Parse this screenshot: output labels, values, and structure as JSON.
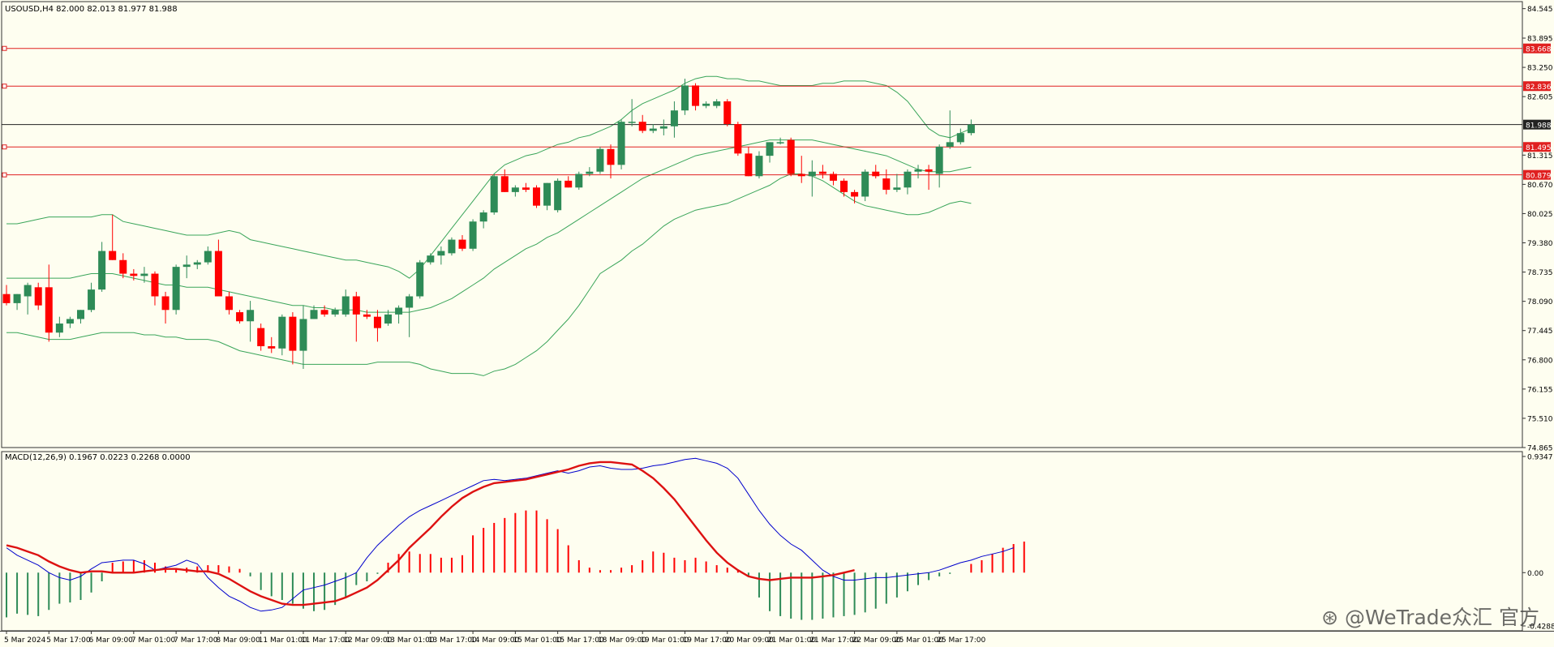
{
  "window": {
    "symbol_header": "USOUSD,H4  82.000 82.013 81.977 81.988",
    "macd_header": "MACD(12,26,9) 0.1967 0.0223 0.2268 0.0000"
  },
  "watermark": "@WeTrade众汇 官方",
  "colors": {
    "background": "#fefef0",
    "bull": "#2e8b57",
    "bear": "#ff0000",
    "band": "#3aa55a",
    "hline": "#e02020",
    "current": "#222222",
    "macd_line": "#0000cc",
    "signal_line": "#dd1111"
  },
  "chart_data": [
    {
      "type": "candlestick",
      "panel": "price",
      "y_range": [
        74.865,
        84.7
      ],
      "y_ticks": [
        "84.545",
        "83.895",
        "83.250",
        "82.605",
        "81.315",
        "80.670",
        "80.025",
        "79.380",
        "78.735",
        "78.090",
        "77.445",
        "76.800",
        "76.155",
        "75.510",
        "74.865"
      ],
      "price_tags": [
        {
          "label": "83.668",
          "value": 83.668,
          "style": "level"
        },
        {
          "label": "82.836",
          "value": 82.836,
          "style": "level"
        },
        {
          "label": "81.988",
          "value": 81.988,
          "style": "current"
        },
        {
          "label": "81.495",
          "value": 81.495,
          "style": "level"
        },
        {
          "label": "80.879",
          "value": 80.879,
          "style": "level"
        }
      ],
      "x_labels": [
        "5 Mar 2024",
        "5 Mar 17:00",
        "6 Mar 09:00",
        "7 Mar 01:00",
        "7 Mar 17:00",
        "8 Mar 09:00",
        "11 Mar 01:00",
        "11 Mar 17:00",
        "12 Mar 09:00",
        "13 Mar 01:00",
        "13 Mar 17:00",
        "14 Mar 09:00",
        "15 Mar 01:00",
        "15 Mar 17:00",
        "18 Mar 09:00",
        "19 Mar 01:00",
        "19 Mar 17:00",
        "20 Mar 09:00",
        "21 Mar 01:00",
        "21 Mar 17:00",
        "22 Mar 09:00",
        "25 Mar 01:00",
        "25 Mar 17:00"
      ],
      "candles": [
        [
          78.25,
          78.45,
          78.0,
          78.05
        ],
        [
          78.05,
          78.25,
          77.9,
          78.25
        ],
        [
          78.2,
          78.5,
          77.8,
          78.45
        ],
        [
          78.4,
          78.5,
          77.9,
          78.0
        ],
        [
          78.4,
          78.9,
          77.2,
          77.4
        ],
        [
          77.4,
          77.75,
          77.3,
          77.6
        ],
        [
          77.6,
          77.75,
          77.5,
          77.7
        ],
        [
          77.7,
          77.9,
          77.6,
          77.9
        ],
        [
          77.9,
          78.5,
          77.85,
          78.35
        ],
        [
          78.35,
          79.4,
          78.3,
          79.2
        ],
        [
          79.2,
          80.0,
          79.0,
          79.0
        ],
        [
          79.0,
          79.15,
          78.6,
          78.7
        ],
        [
          78.7,
          78.8,
          78.55,
          78.65
        ],
        [
          78.65,
          78.85,
          78.5,
          78.7
        ],
        [
          78.7,
          78.75,
          78.0,
          78.2
        ],
        [
          78.2,
          78.3,
          77.6,
          77.9
        ],
        [
          77.9,
          78.9,
          77.8,
          78.85
        ],
        [
          78.85,
          79.1,
          78.6,
          78.9
        ],
        [
          78.9,
          79.0,
          78.8,
          78.95
        ],
        [
          78.95,
          79.3,
          78.9,
          79.2
        ],
        [
          79.2,
          79.45,
          78.2,
          78.2
        ],
        [
          78.2,
          78.3,
          77.8,
          77.9
        ],
        [
          77.85,
          77.9,
          77.6,
          77.65
        ],
        [
          77.65,
          78.1,
          77.2,
          77.9
        ],
        [
          77.5,
          77.6,
          77.0,
          77.1
        ],
        [
          77.1,
          77.3,
          76.95,
          77.05
        ],
        [
          77.05,
          77.8,
          76.9,
          77.75
        ],
        [
          77.75,
          77.85,
          76.7,
          77.0
        ],
        [
          77.0,
          78.0,
          76.6,
          77.7
        ],
        [
          77.7,
          78.0,
          77.7,
          77.9
        ],
        [
          77.9,
          78.0,
          77.75,
          77.8
        ],
        [
          77.8,
          77.95,
          77.75,
          77.9
        ],
        [
          77.8,
          78.35,
          77.75,
          78.2
        ],
        [
          78.2,
          78.3,
          77.2,
          77.8
        ],
        [
          77.8,
          77.9,
          77.7,
          77.75
        ],
        [
          77.75,
          77.9,
          77.2,
          77.5
        ],
        [
          77.6,
          77.9,
          77.55,
          77.8
        ],
        [
          77.8,
          78.0,
          77.6,
          77.95
        ],
        [
          77.95,
          78.25,
          77.3,
          78.2
        ],
        [
          78.2,
          79.0,
          78.15,
          78.95
        ],
        [
          78.95,
          79.15,
          78.9,
          79.1
        ],
        [
          79.1,
          79.3,
          78.9,
          79.2
        ],
        [
          79.15,
          79.5,
          79.1,
          79.45
        ],
        [
          79.45,
          79.55,
          79.2,
          79.25
        ],
        [
          79.25,
          79.9,
          79.2,
          79.85
        ],
        [
          79.85,
          80.1,
          79.7,
          80.05
        ],
        [
          80.05,
          80.9,
          80.0,
          80.85
        ],
        [
          80.85,
          81.0,
          80.5,
          80.5
        ],
        [
          80.5,
          80.65,
          80.4,
          80.6
        ],
        [
          80.6,
          80.7,
          80.5,
          80.55
        ],
        [
          80.6,
          80.65,
          80.15,
          80.2
        ],
        [
          80.2,
          80.7,
          80.1,
          80.7
        ],
        [
          80.1,
          80.8,
          80.05,
          80.75
        ],
        [
          80.75,
          80.85,
          80.6,
          80.6
        ],
        [
          80.6,
          80.95,
          80.55,
          80.9
        ],
        [
          80.9,
          81.05,
          80.85,
          80.95
        ],
        [
          80.95,
          81.5,
          80.9,
          81.45
        ],
        [
          81.45,
          81.55,
          80.8,
          81.1
        ],
        [
          81.1,
          82.1,
          81.0,
          82.05
        ],
        [
          82.05,
          82.55,
          81.95,
          82.05
        ],
        [
          82.05,
          82.2,
          81.8,
          81.85
        ],
        [
          81.85,
          82.0,
          81.8,
          81.9
        ],
        [
          81.9,
          82.1,
          81.75,
          81.95
        ],
        [
          81.95,
          82.5,
          81.7,
          82.3
        ],
        [
          82.3,
          83.0,
          82.2,
          82.85
        ],
        [
          82.85,
          82.9,
          82.3,
          82.4
        ],
        [
          82.4,
          82.5,
          82.35,
          82.45
        ],
        [
          82.4,
          82.55,
          82.35,
          82.5
        ],
        [
          82.5,
          82.55,
          81.95,
          82.0
        ],
        [
          82.0,
          82.05,
          81.3,
          81.35
        ],
        [
          81.35,
          81.5,
          80.85,
          80.85
        ],
        [
          80.85,
          81.4,
          80.8,
          81.3
        ],
        [
          81.3,
          81.6,
          81.15,
          81.6
        ],
        [
          81.6,
          81.7,
          81.55,
          81.6
        ],
        [
          81.65,
          81.7,
          80.85,
          80.9
        ],
        [
          80.9,
          81.3,
          80.7,
          80.85
        ],
        [
          80.85,
          81.2,
          80.4,
          80.95
        ],
        [
          80.95,
          81.1,
          80.8,
          80.9
        ],
        [
          80.9,
          80.95,
          80.65,
          80.75
        ],
        [
          80.75,
          80.8,
          80.4,
          80.5
        ],
        [
          80.5,
          80.55,
          80.25,
          80.4
        ],
        [
          80.4,
          81.0,
          80.3,
          80.95
        ],
        [
          80.95,
          81.1,
          80.8,
          80.85
        ],
        [
          80.8,
          81.0,
          80.45,
          80.55
        ],
        [
          80.55,
          80.9,
          80.5,
          80.6
        ],
        [
          80.6,
          81.0,
          80.45,
          80.95
        ],
        [
          80.95,
          81.1,
          80.8,
          81.0
        ],
        [
          81.0,
          81.1,
          80.55,
          80.95
        ],
        [
          80.9,
          81.55,
          80.6,
          81.5
        ],
        [
          81.5,
          82.3,
          81.45,
          81.6
        ],
        [
          81.6,
          81.9,
          81.55,
          81.8
        ],
        [
          81.8,
          82.1,
          81.75,
          81.988
        ]
      ],
      "bands": {
        "upper": [
          79.8,
          79.8,
          79.85,
          79.9,
          79.95,
          79.95,
          79.95,
          79.95,
          79.95,
          80.0,
          80.0,
          79.85,
          79.8,
          79.75,
          79.7,
          79.65,
          79.6,
          79.55,
          79.55,
          79.55,
          79.6,
          79.65,
          79.6,
          79.45,
          79.4,
          79.35,
          79.3,
          79.25,
          79.2,
          79.15,
          79.1,
          79.05,
          79.0,
          79.0,
          78.95,
          78.9,
          78.85,
          78.75,
          78.6,
          78.8,
          79.1,
          79.4,
          79.7,
          80.0,
          80.3,
          80.6,
          80.9,
          81.1,
          81.2,
          81.3,
          81.35,
          81.45,
          81.55,
          81.6,
          81.7,
          81.75,
          81.85,
          81.95,
          82.1,
          82.3,
          82.45,
          82.55,
          82.65,
          82.75,
          82.9,
          83.0,
          83.05,
          83.05,
          83.0,
          83.0,
          82.95,
          82.95,
          82.9,
          82.85,
          82.85,
          82.85,
          82.85,
          82.9,
          82.9,
          82.95,
          82.95,
          82.95,
          82.9,
          82.85,
          82.7,
          82.5,
          82.2,
          81.9,
          81.75,
          81.7,
          81.8,
          81.9
        ],
        "middle": [
          78.6,
          78.6,
          78.6,
          78.6,
          78.6,
          78.6,
          78.6,
          78.65,
          78.7,
          78.7,
          78.7,
          78.65,
          78.6,
          78.55,
          78.5,
          78.45,
          78.45,
          78.4,
          78.4,
          78.4,
          78.35,
          78.3,
          78.25,
          78.2,
          78.15,
          78.1,
          78.05,
          78.0,
          78.0,
          77.95,
          77.95,
          77.9,
          77.9,
          77.9,
          77.85,
          77.85,
          77.85,
          77.85,
          77.85,
          77.9,
          77.95,
          78.05,
          78.15,
          78.3,
          78.45,
          78.6,
          78.8,
          78.95,
          79.1,
          79.25,
          79.35,
          79.5,
          79.6,
          79.75,
          79.9,
          80.05,
          80.2,
          80.35,
          80.5,
          80.65,
          80.8,
          80.9,
          81.0,
          81.1,
          81.2,
          81.3,
          81.35,
          81.4,
          81.45,
          81.5,
          81.55,
          81.6,
          81.65,
          81.65,
          81.65,
          81.65,
          81.65,
          81.6,
          81.55,
          81.5,
          81.45,
          81.4,
          81.35,
          81.3,
          81.2,
          81.1,
          81.0,
          80.95,
          80.95,
          80.95,
          81.0,
          81.05
        ],
        "lower": [
          77.4,
          77.4,
          77.35,
          77.3,
          77.25,
          77.25,
          77.25,
          77.3,
          77.35,
          77.4,
          77.4,
          77.4,
          77.4,
          77.35,
          77.35,
          77.3,
          77.3,
          77.25,
          77.25,
          77.25,
          77.2,
          77.1,
          77.0,
          76.95,
          76.9,
          76.85,
          76.8,
          76.75,
          76.7,
          76.7,
          76.7,
          76.7,
          76.7,
          76.7,
          76.7,
          76.75,
          76.75,
          76.75,
          76.75,
          76.7,
          76.6,
          76.55,
          76.5,
          76.5,
          76.5,
          76.45,
          76.55,
          76.6,
          76.7,
          76.85,
          77.0,
          77.2,
          77.45,
          77.7,
          78.0,
          78.35,
          78.7,
          78.85,
          79.0,
          79.2,
          79.35,
          79.55,
          79.75,
          79.9,
          80.0,
          80.1,
          80.15,
          80.2,
          80.25,
          80.35,
          80.45,
          80.55,
          80.65,
          80.8,
          80.9,
          80.9,
          80.85,
          80.75,
          80.6,
          80.45,
          80.3,
          80.2,
          80.15,
          80.1,
          80.05,
          80.0,
          80.0,
          80.05,
          80.15,
          80.25,
          80.3,
          80.25
        ]
      }
    },
    {
      "type": "macd",
      "panel": "indicator",
      "y_range": [
        -0.4288,
        0.9347
      ],
      "y_ticks": [
        "0.9347",
        "0.00",
        "-0.4288"
      ],
      "histogram": [
        -0.36,
        -0.33,
        -0.34,
        -0.35,
        -0.3,
        -0.25,
        -0.24,
        -0.22,
        -0.16,
        -0.07,
        0.08,
        0.09,
        0.1,
        0.1,
        0.08,
        0.05,
        0.03,
        0.04,
        0.05,
        0.06,
        0.06,
        0.05,
        0.03,
        -0.03,
        -0.14,
        -0.19,
        -0.22,
        -0.25,
        -0.29,
        -0.31,
        -0.3,
        -0.26,
        -0.2,
        -0.1,
        -0.07,
        -0.01,
        0.08,
        0.15,
        0.17,
        0.15,
        0.15,
        0.12,
        0.12,
        0.14,
        0.3,
        0.36,
        0.4,
        0.44,
        0.48,
        0.5,
        0.5,
        0.43,
        0.35,
        0.22,
        0.1,
        0.04,
        0.02,
        0.02,
        0.04,
        0.06,
        0.1,
        0.17,
        0.16,
        0.12,
        0.1,
        0.12,
        0.09,
        0.06,
        0.04,
        0.02,
        -0.03,
        -0.2,
        -0.31,
        -0.35,
        -0.37,
        -0.38,
        -0.38,
        -0.37,
        -0.36,
        -0.35,
        -0.34,
        -0.32,
        -0.29,
        -0.25,
        -0.2,
        -0.15,
        -0.1,
        -0.06,
        -0.03,
        -0.01,
        0.0,
        0.07,
        0.1,
        0.15,
        0.2,
        0.23,
        0.25
      ],
      "macd_line": [
        0.2,
        0.14,
        0.1,
        0.06,
        0.0,
        -0.04,
        -0.06,
        -0.03,
        0.03,
        0.08,
        0.09,
        0.1,
        0.1,
        0.07,
        0.02,
        0.04,
        0.06,
        0.1,
        0.07,
        -0.04,
        -0.12,
        -0.19,
        -0.23,
        -0.28,
        -0.31,
        -0.3,
        -0.28,
        -0.21,
        -0.14,
        -0.12,
        -0.1,
        -0.07,
        -0.04,
        0.0,
        0.12,
        0.22,
        0.3,
        0.38,
        0.45,
        0.5,
        0.54,
        0.58,
        0.62,
        0.66,
        0.7,
        0.74,
        0.75,
        0.74,
        0.75,
        0.76,
        0.78,
        0.8,
        0.82,
        0.8,
        0.82,
        0.85,
        0.86,
        0.84,
        0.83,
        0.83,
        0.84,
        0.86,
        0.87,
        0.89,
        0.91,
        0.92,
        0.9,
        0.88,
        0.84,
        0.76,
        0.63,
        0.5,
        0.39,
        0.3,
        0.23,
        0.18,
        0.1,
        0.02,
        -0.03,
        -0.06,
        -0.06,
        -0.05,
        -0.04,
        -0.04,
        -0.03,
        -0.02,
        -0.01,
        0.0,
        0.02,
        0.05,
        0.08,
        0.1,
        0.13,
        0.15,
        0.17,
        0.2
      ],
      "signal_line": [
        0.22,
        0.2,
        0.17,
        0.14,
        0.09,
        0.05,
        0.02,
        0.0,
        0.01,
        0.01,
        0.0,
        0.0,
        0.0,
        0.01,
        0.02,
        0.03,
        0.03,
        0.02,
        0.01,
        0.01,
        -0.01,
        -0.05,
        -0.1,
        -0.15,
        -0.19,
        -0.22,
        -0.25,
        -0.26,
        -0.26,
        -0.25,
        -0.24,
        -0.23,
        -0.2,
        -0.16,
        -0.12,
        -0.06,
        0.02,
        0.1,
        0.2,
        0.28,
        0.36,
        0.45,
        0.53,
        0.6,
        0.65,
        0.69,
        0.72,
        0.73,
        0.74,
        0.75,
        0.77,
        0.79,
        0.81,
        0.83,
        0.86,
        0.88,
        0.89,
        0.89,
        0.88,
        0.87,
        0.82,
        0.76,
        0.68,
        0.59,
        0.48,
        0.37,
        0.26,
        0.16,
        0.08,
        0.02,
        -0.03,
        -0.05,
        -0.06,
        -0.05,
        -0.04,
        -0.04,
        -0.04,
        -0.03,
        -0.02,
        0.0,
        0.02
      ]
    }
  ]
}
